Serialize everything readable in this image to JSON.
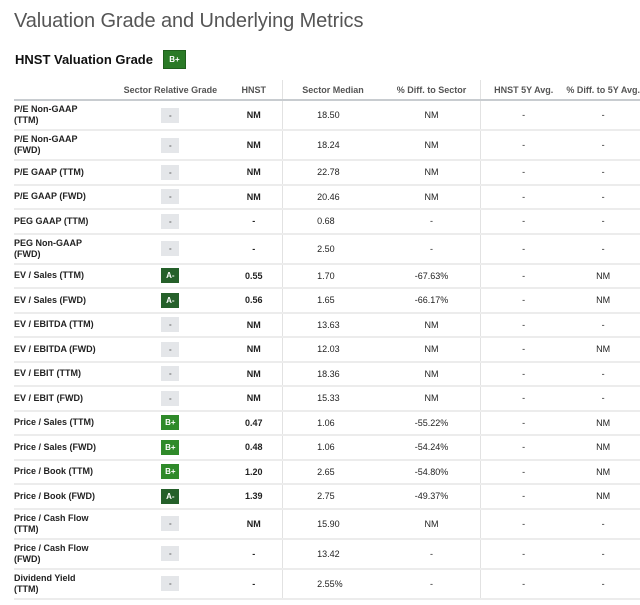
{
  "page": {
    "title": "Valuation Grade and Underlying Metrics",
    "grade_heading": "HNST Valuation Grade",
    "overall_grade": "B+"
  },
  "colors": {
    "grade_b_plus": "#2f8a2a",
    "grade_a_minus": "#25602a",
    "grade_none": "#e4e6e9"
  },
  "table": {
    "headers": {
      "metric": "",
      "grade": "Sector Relative Grade",
      "hnst": "HNST",
      "sector_median": "Sector Median",
      "diff_sector": "% Diff. to Sector",
      "avg_5y": "HNST 5Y Avg.",
      "diff_5y": "% Diff. to 5Y Avg."
    },
    "rows": [
      {
        "line1": "P/E Non-GAAP",
        "line2": "(TTM)",
        "grade": "-",
        "hnst": "NM",
        "median": "18.50",
        "diff": "NM",
        "avg5y": "-",
        "diff5y": "-"
      },
      {
        "line1": "P/E Non-GAAP",
        "line2": "(FWD)",
        "grade": "-",
        "hnst": "NM",
        "median": "18.24",
        "diff": "NM",
        "avg5y": "-",
        "diff5y": "-"
      },
      {
        "line1": "P/E GAAP (TTM)",
        "line2": "",
        "grade": "-",
        "hnst": "NM",
        "median": "22.78",
        "diff": "NM",
        "avg5y": "-",
        "diff5y": "-"
      },
      {
        "line1": "P/E GAAP (FWD)",
        "line2": "",
        "grade": "-",
        "hnst": "NM",
        "median": "20.46",
        "diff": "NM",
        "avg5y": "-",
        "diff5y": "-"
      },
      {
        "line1": "PEG GAAP (TTM)",
        "line2": "",
        "grade": "-",
        "hnst": "-",
        "median": "0.68",
        "diff": "-",
        "avg5y": "-",
        "diff5y": "-"
      },
      {
        "line1": "PEG Non-GAAP",
        "line2": "(FWD)",
        "grade": "-",
        "hnst": "-",
        "median": "2.50",
        "diff": "-",
        "avg5y": "-",
        "diff5y": "-"
      },
      {
        "line1": "EV / Sales (TTM)",
        "line2": "",
        "grade": "A-",
        "hnst": "0.55",
        "median": "1.70",
        "diff": "-67.63%",
        "avg5y": "-",
        "diff5y": "NM"
      },
      {
        "line1": "EV / Sales (FWD)",
        "line2": "",
        "grade": "A-",
        "hnst": "0.56",
        "median": "1.65",
        "diff": "-66.17%",
        "avg5y": "-",
        "diff5y": "NM"
      },
      {
        "line1": "EV / EBITDA (TTM)",
        "line2": "",
        "grade": "-",
        "hnst": "NM",
        "median": "13.63",
        "diff": "NM",
        "avg5y": "-",
        "diff5y": "-"
      },
      {
        "line1": "EV / EBITDA (FWD)",
        "line2": "",
        "grade": "-",
        "hnst": "NM",
        "median": "12.03",
        "diff": "NM",
        "avg5y": "-",
        "diff5y": "NM"
      },
      {
        "line1": "EV / EBIT (TTM)",
        "line2": "",
        "grade": "-",
        "hnst": "NM",
        "median": "18.36",
        "diff": "NM",
        "avg5y": "-",
        "diff5y": "-"
      },
      {
        "line1": "EV / EBIT (FWD)",
        "line2": "",
        "grade": "-",
        "hnst": "NM",
        "median": "15.33",
        "diff": "NM",
        "avg5y": "-",
        "diff5y": "-"
      },
      {
        "line1": "Price / Sales (TTM)",
        "line2": "",
        "grade": "B+",
        "hnst": "0.47",
        "median": "1.06",
        "diff": "-55.22%",
        "avg5y": "-",
        "diff5y": "NM"
      },
      {
        "line1": "Price / Sales (FWD)",
        "line2": "",
        "grade": "B+",
        "hnst": "0.48",
        "median": "1.06",
        "diff": "-54.24%",
        "avg5y": "-",
        "diff5y": "NM"
      },
      {
        "line1": "Price / Book (TTM)",
        "line2": "",
        "grade": "B+",
        "hnst": "1.20",
        "median": "2.65",
        "diff": "-54.80%",
        "avg5y": "-",
        "diff5y": "NM"
      },
      {
        "line1": "Price / Book (FWD)",
        "line2": "",
        "grade": "A-",
        "hnst": "1.39",
        "median": "2.75",
        "diff": "-49.37%",
        "avg5y": "-",
        "diff5y": "NM"
      },
      {
        "line1": "Price / Cash Flow",
        "line2": "(TTM)",
        "grade": "-",
        "hnst": "NM",
        "median": "15.90",
        "diff": "NM",
        "avg5y": "-",
        "diff5y": "-"
      },
      {
        "line1": "Price / Cash Flow",
        "line2": "(FWD)",
        "grade": "-",
        "hnst": "-",
        "median": "13.42",
        "diff": "-",
        "avg5y": "-",
        "diff5y": "-"
      },
      {
        "line1": "Dividend Yield",
        "line2": "(TTM)",
        "grade": "-",
        "hnst": "-",
        "median": "2.55%",
        "diff": "-",
        "avg5y": "-",
        "diff5y": "-"
      }
    ]
  }
}
